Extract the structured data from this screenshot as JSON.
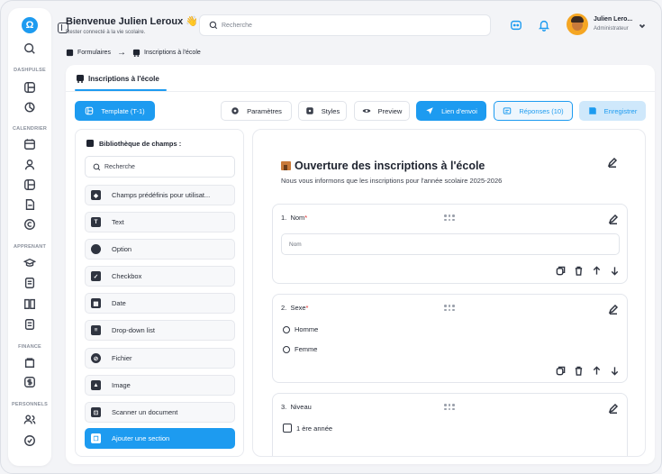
{
  "sidebar": {
    "logo_letter": "Ω",
    "sections": {
      "dashpulse": "DASHPULSE",
      "calendrier": "CALENDRIER",
      "apprenant": "APPRENANT",
      "finance": "FINANCE",
      "personnels": "PERSONNELS"
    }
  },
  "header": {
    "welcome": "Bienvenue Julien Leroux",
    "welcome_emoji": "👋",
    "subtitle": "Rester connecté à la vie scolaire.",
    "search_placeholder": "Recherche",
    "user_name": "Julien Lero...",
    "user_role": "Administrateur"
  },
  "breadcrumb": {
    "parent": "Formulaires",
    "separator": "→",
    "current": "Inscriptions à l'école"
  },
  "tab": {
    "label": "Inscriptions à l'école"
  },
  "toolbar": {
    "template": "Template (T-1)",
    "parametres": "Paramètres",
    "styles": "Styles",
    "preview": "Preview",
    "lien_envoi": "Lien d'envoi",
    "reponses": "Réponses (10)",
    "enregistrer": "Enregistrer"
  },
  "library": {
    "title": "Bibliothèque de champs :",
    "search_placeholder": "Recherche",
    "items": [
      {
        "label": "Champs prédéfinis pour utilisat...",
        "icon": "diamond-icon"
      },
      {
        "label": "Text",
        "icon": "text-icon"
      },
      {
        "label": "Option",
        "icon": "radio-icon"
      },
      {
        "label": "Checkbox",
        "icon": "checkbox-icon"
      },
      {
        "label": "Date",
        "icon": "calendar-icon"
      },
      {
        "label": "Drop-down list",
        "icon": "dropdown-icon"
      },
      {
        "label": "Fichier",
        "icon": "file-icon"
      },
      {
        "label": "Image",
        "icon": "image-icon"
      },
      {
        "label": "Scanner un document",
        "icon": "scan-icon"
      },
      {
        "label": "Ajouter une section",
        "icon": "section-icon"
      }
    ]
  },
  "form": {
    "title": "Ouverture des inscriptions à l'école",
    "description": "Nous vous informons que les inscriptions pour l'année scolaire 2025-2026",
    "questions": [
      {
        "number": "1.",
        "label": "Nom",
        "required": "*",
        "placeholder": "Nom"
      },
      {
        "number": "2.",
        "label": "Sexe",
        "required": "*",
        "options": [
          "Homme",
          "Femme"
        ]
      },
      {
        "number": "3.",
        "label": "Niveau",
        "required": "",
        "options": [
          "1 ère année"
        ]
      }
    ]
  },
  "colors": {
    "accent": "#1d9bf0",
    "required": "#e02424"
  }
}
